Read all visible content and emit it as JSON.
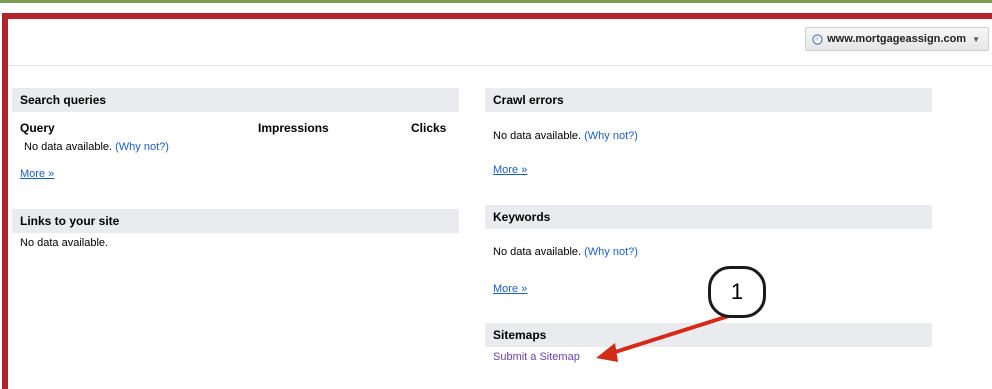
{
  "header": {
    "site_selector": "www.mortgageassign.com"
  },
  "search_queries": {
    "title": "Search queries",
    "columns": [
      "Query",
      "Impressions",
      "Clicks"
    ],
    "empty_text": "No data available.",
    "why_not": "(Why not?)",
    "more": "More »"
  },
  "links": {
    "title": "Links to your site",
    "empty_text": "No data available."
  },
  "crawl_errors": {
    "title": "Crawl errors",
    "empty_text": "No data available.",
    "why_not": "(Why not?)",
    "more": "More »"
  },
  "keywords": {
    "title": "Keywords",
    "empty_text": "No data available.",
    "why_not": "(Why not?)",
    "more": "More »"
  },
  "sitemaps": {
    "title": "Sitemaps",
    "submit_link": "Submit a Sitemap"
  },
  "annotation": {
    "number": "1",
    "color": "#d42a18"
  }
}
